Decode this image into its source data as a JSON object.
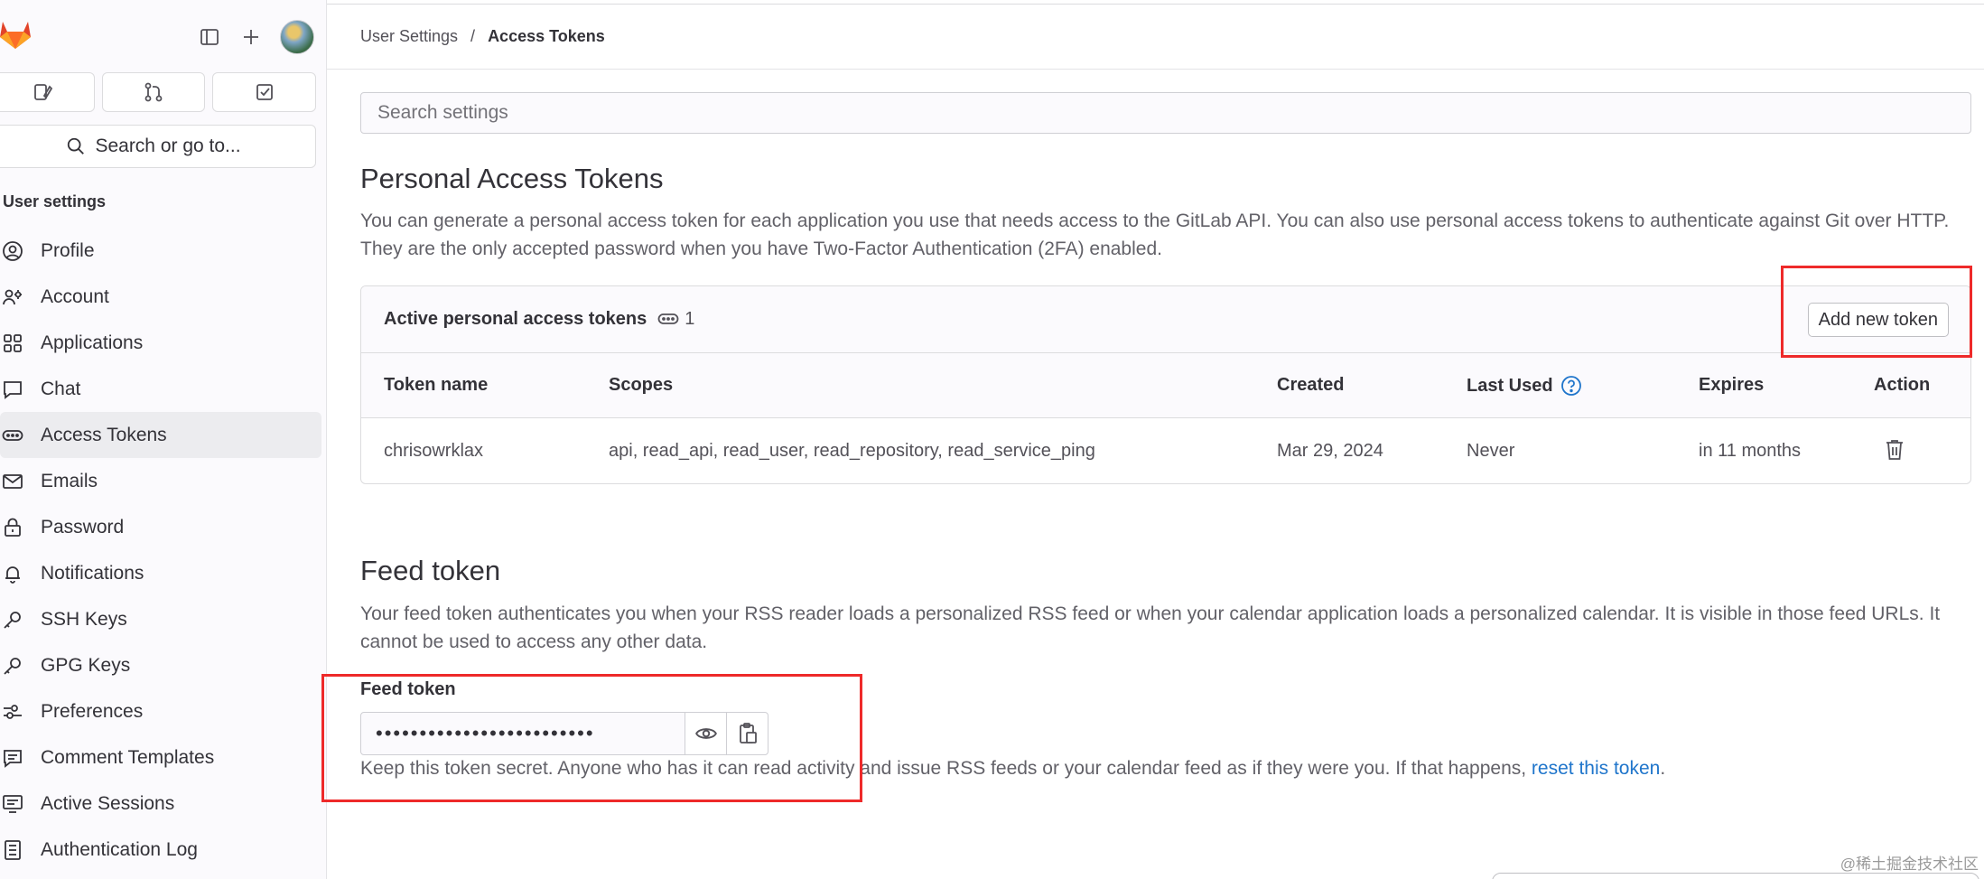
{
  "sidebar": {
    "heading": "User settings",
    "search_label": "Search or go to...",
    "items": [
      {
        "label": "Profile",
        "icon": "profile-icon"
      },
      {
        "label": "Account",
        "icon": "account-icon"
      },
      {
        "label": "Applications",
        "icon": "applications-icon"
      },
      {
        "label": "Chat",
        "icon": "chat-icon"
      },
      {
        "label": "Access Tokens",
        "icon": "token-icon",
        "active": true
      },
      {
        "label": "Emails",
        "icon": "mail-icon"
      },
      {
        "label": "Password",
        "icon": "lock-icon"
      },
      {
        "label": "Notifications",
        "icon": "bell-icon"
      },
      {
        "label": "SSH Keys",
        "icon": "key-icon"
      },
      {
        "label": "GPG Keys",
        "icon": "key-icon"
      },
      {
        "label": "Preferences",
        "icon": "preferences-icon"
      },
      {
        "label": "Comment Templates",
        "icon": "comment-icon"
      },
      {
        "label": "Active Sessions",
        "icon": "monitor-icon"
      },
      {
        "label": "Authentication Log",
        "icon": "log-icon"
      }
    ]
  },
  "breadcrumb": {
    "parent": "User Settings",
    "separator": "/",
    "current": "Access Tokens"
  },
  "search": {
    "placeholder": "Search settings"
  },
  "pat": {
    "title": "Personal Access Tokens",
    "description": "You can generate a personal access token for each application you use that needs access to the GitLab API. You can also use personal access tokens to authenticate against Git over HTTP. They are the only accepted password when you have Two-Factor Authentication (2FA) enabled.",
    "card_title": "Active personal access tokens",
    "count": "1",
    "add_button": "Add new token",
    "columns": [
      "Token name",
      "Scopes",
      "Created",
      "Last Used",
      "Expires",
      "Action"
    ],
    "rows": [
      {
        "name": "chrisowrklax",
        "scopes": "api, read_api, read_user, read_repository, read_service_ping",
        "created": "Mar 29, 2024",
        "last_used": "Never",
        "expires": "in 11 months"
      }
    ]
  },
  "feed": {
    "title": "Feed token",
    "description": "Your feed token authenticates you when your RSS reader loads a personalized RSS feed or when your calendar application loads a personalized calendar. It is visible in those feed URLs. It cannot be used to access any other data.",
    "label": "Feed token",
    "masked_value": "•••••••••••••••••••••••••",
    "help_text": "Keep this token secret. Anyone who has it can read activity and issue RSS feeds or your calendar feed as if they were you. If that happens, ",
    "help_link": "reset this token",
    "help_end": "."
  },
  "watermark": "@稀土掘金技术社区",
  "colors": {
    "accent": "#1f75cb",
    "annotation": "#ee2a2a",
    "logo": "#e24329"
  }
}
